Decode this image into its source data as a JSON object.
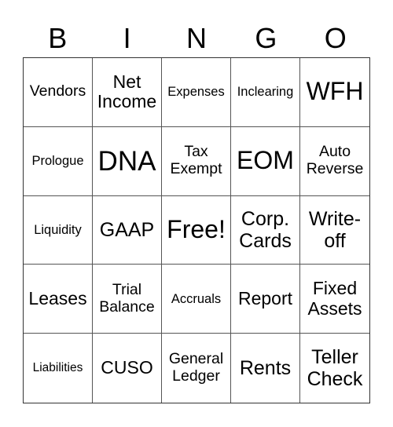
{
  "header": [
    "B",
    "I",
    "N",
    "G",
    "O"
  ],
  "cells": [
    [
      "Vendors",
      "Net Income",
      "Expenses",
      "Inclearing",
      "WFH"
    ],
    [
      "Prologue",
      "DNA",
      "Tax Exempt",
      "EOM",
      "Auto Reverse"
    ],
    [
      "Liquidity",
      "GAAP",
      "Free!",
      "Corp. Cards",
      "Write-off"
    ],
    [
      "Leases",
      "Trial Balance",
      "Accruals",
      "Report",
      "Fixed Assets"
    ],
    [
      "Liabilities",
      "CUSO",
      "General Ledger",
      "Rents",
      "Teller Check"
    ]
  ]
}
